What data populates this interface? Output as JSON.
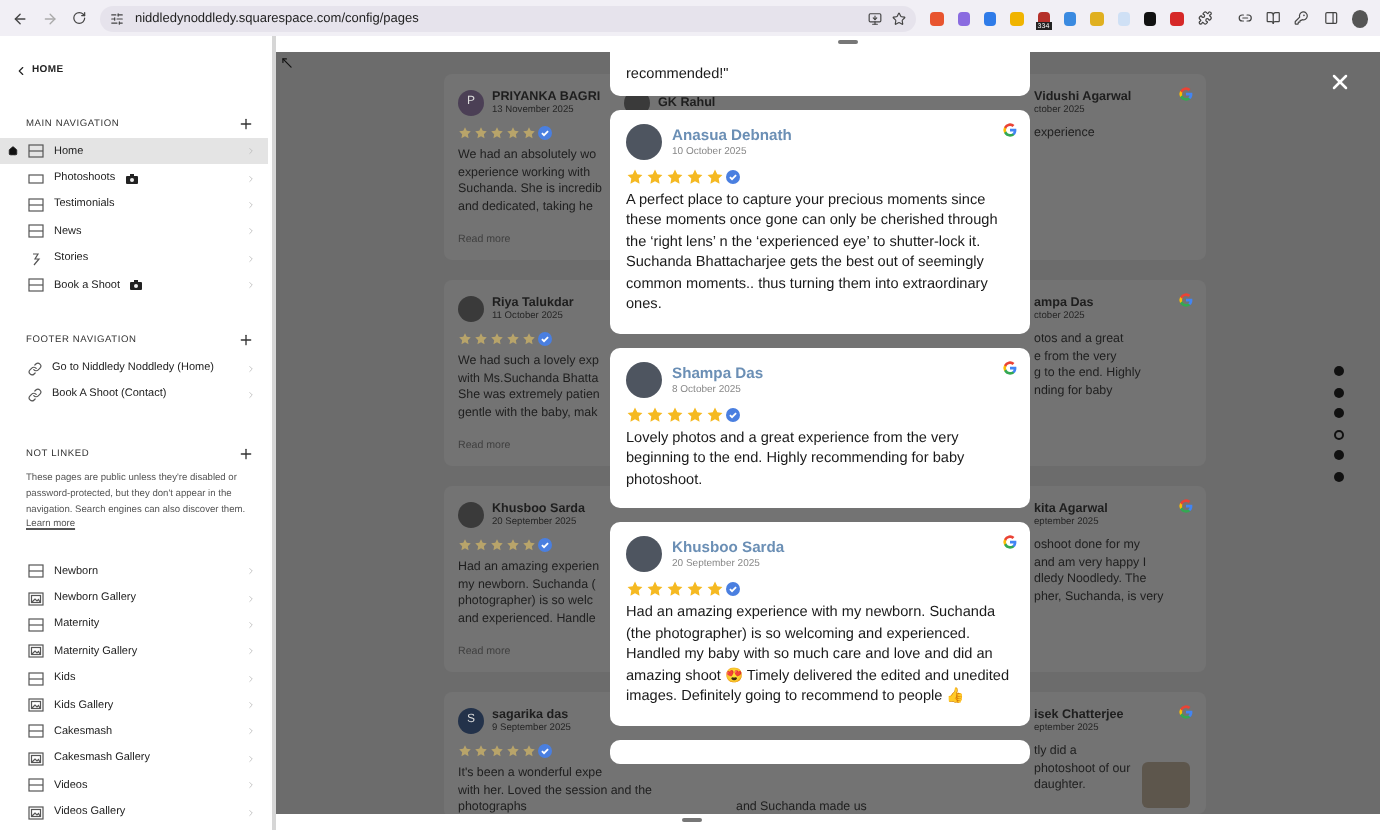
{
  "browser": {
    "url": "niddledynoddledy.squarespace.com/config/pages",
    "extension_badge": "334"
  },
  "sidebar": {
    "back_label": "HOME",
    "sections": [
      {
        "title": "MAIN NAVIGATION",
        "items": [
          {
            "label": "Home",
            "kind": "page",
            "selected": true,
            "homepage": true,
            "camera": false
          },
          {
            "label": "Photoshoots",
            "kind": "index",
            "selected": false,
            "homepage": false,
            "camera": true
          },
          {
            "label": "Testimonials",
            "kind": "page",
            "selected": false,
            "homepage": false,
            "camera": false
          },
          {
            "label": "News",
            "kind": "page",
            "selected": false,
            "homepage": false,
            "camera": false
          },
          {
            "label": "Stories",
            "kind": "blog",
            "selected": false,
            "homepage": false,
            "camera": false
          },
          {
            "label": "Book a Shoot",
            "kind": "page",
            "selected": false,
            "homepage": false,
            "camera": true
          }
        ]
      },
      {
        "title": "FOOTER NAVIGATION",
        "items": [
          {
            "label": "Go to Niddledy Noddledy (Home)",
            "kind": "link",
            "selected": false,
            "homepage": false,
            "camera": false
          },
          {
            "label": "Book A Shoot (Contact)",
            "kind": "link",
            "selected": false,
            "homepage": false,
            "camera": false
          }
        ]
      },
      {
        "title": "NOT LINKED",
        "description": "These pages are public unless they're disabled or password-protected, but they don't appear in the navigation. Search engines can also discover them.",
        "link": "Learn more",
        "items": [
          {
            "label": "Newborn",
            "kind": "page",
            "selected": false,
            "homepage": false,
            "camera": false
          },
          {
            "label": "Newborn Gallery",
            "kind": "gallery",
            "selected": false,
            "homepage": false,
            "camera": false
          },
          {
            "label": "Maternity",
            "kind": "page",
            "selected": false,
            "homepage": false,
            "camera": false
          },
          {
            "label": "Maternity Gallery",
            "kind": "gallery",
            "selected": false,
            "homepage": false,
            "camera": false
          },
          {
            "label": "Kids",
            "kind": "page",
            "selected": false,
            "homepage": false,
            "camera": false
          },
          {
            "label": "Kids Gallery",
            "kind": "gallery",
            "selected": false,
            "homepage": false,
            "camera": false
          },
          {
            "label": "Cakesmash",
            "kind": "page",
            "selected": false,
            "homepage": false,
            "camera": false
          },
          {
            "label": "Cakesmash Gallery",
            "kind": "gallery",
            "selected": false,
            "homepage": false,
            "camera": false
          },
          {
            "label": "Videos",
            "kind": "page",
            "selected": false,
            "homepage": false,
            "camera": false
          },
          {
            "label": "Videos Gallery",
            "kind": "gallery",
            "selected": false,
            "homepage": false,
            "camera": false
          }
        ]
      }
    ]
  },
  "background_reviews": {
    "left": [
      {
        "avatar_letter": "P",
        "name": "PRIYANKA BAGRI",
        "date": "13 November 2025",
        "stars": 5,
        "lines": [
          "We had an absolutely wo",
          "experience working with",
          "Suchanda. She is incredib",
          "and dedicated, taking he"
        ],
        "read_more": "Read more"
      },
      {
        "name": "Riya Talukdar",
        "date": "11 October 2025",
        "stars": 5,
        "lines": [
          "We had such a lovely exp",
          "with Ms.Suchanda Bhatta",
          "She was extremely patien",
          "gentle with the baby, mak"
        ],
        "read_more": "Read more"
      },
      {
        "name": "Khusboo Sarda",
        "date": "20 September 2025",
        "stars": 5,
        "lines": [
          "Had an amazing experien",
          "my newborn. Suchanda (",
          "photographer) is so welc",
          "and experienced. Handle"
        ],
        "read_more": "Read more"
      },
      {
        "avatar_letter": "S",
        "name": "sagarika das",
        "date": "9 September 2025",
        "stars": 5,
        "lines": [
          "It's been a wonderful expe",
          "with her. Loved the session and the",
          "photographs"
        ]
      }
    ],
    "middle": [
      {
        "kind": "header",
        "name": "GK Rahul"
      },
      {
        "kind": "blank"
      },
      {
        "kind": "blank"
      },
      {
        "kind": "text",
        "lines": [
          "and Suchanda made us"
        ]
      }
    ],
    "right": [
      {
        "name": "Vidushi Agarwal",
        "date": "ctober 2025",
        "lines": [
          "experience"
        ]
      },
      {
        "name": "ampa Das",
        "date": "ctober 2025",
        "lines": [
          "otos and a great",
          "e from the very",
          "g to the end. Highly",
          "nding for baby"
        ]
      },
      {
        "name": "kita Agarwal",
        "date": "eptember 2025",
        "lines": [
          "oshoot done for my",
          "and am very happy I",
          "dledy Noodledy. The",
          "pher, Suchanda, is very"
        ]
      },
      {
        "name": "isek Chatterjee",
        "date": "eptember 2025",
        "lines": [
          "tly did a",
          "photoshoot of our",
          "daughter."
        ],
        "photo": true
      }
    ]
  },
  "popup_reviews": [
    {
      "kind": "tail",
      "text": "recommended!\""
    },
    {
      "kind": "full",
      "name": "Anasua Debnath",
      "date": "10 October 2025",
      "stars": 5,
      "text": "A perfect place to capture your precious moments since these moments once gone can only be cherished through the ‘right lens’ n the ‘experienced eye’ to shutter-lock it. Suchanda Bhattacharjee gets the best out of seemingly common moments.. thus turning them into extraordinary ones."
    },
    {
      "kind": "full",
      "name": "Shampa Das",
      "date": "8 October 2025",
      "stars": 5,
      "text": "Lovely photos and a great experience from the very beginning to the end. Highly recommending for baby photoshoot."
    },
    {
      "kind": "full",
      "name": "Khusboo Sarda",
      "date": "20 September 2025",
      "stars": 5,
      "text": "Had an amazing experience with my newborn. Suchanda (the photographer) is so welcoming and experienced. Handled my baby with so much care and love and did an amazing shoot 😍 Timely delivered the edited and unedited images. Definitely going to recommend to people 👍"
    },
    {
      "kind": "stub"
    }
  ],
  "carousel_dots": [
    {
      "selected": false
    },
    {
      "selected": false
    },
    {
      "selected": false
    },
    {
      "selected": true
    },
    {
      "selected": false
    },
    {
      "selected": false
    }
  ]
}
